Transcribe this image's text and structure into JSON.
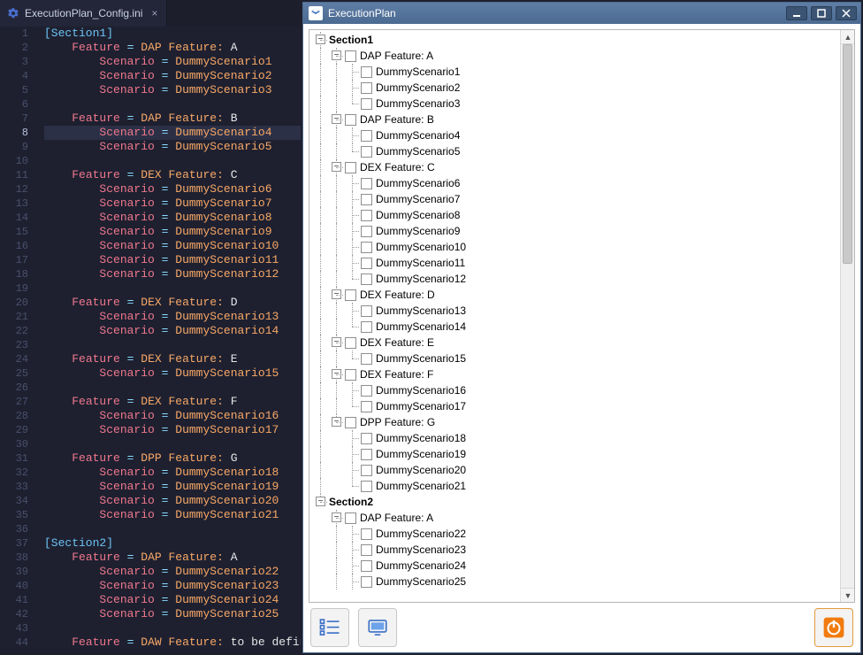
{
  "colors": {
    "editor_bg": "#1e2030",
    "section": "#6cc4f5",
    "key": "#f0788c",
    "eq": "#89ddff",
    "ident": "#f8a866",
    "val": "#e6e6e6",
    "titlebar": "#4b6a91",
    "accent_orange": "#f27b0f"
  },
  "editor": {
    "tab_title": "ExecutionPlan_Config.ini",
    "highlight_line": 8,
    "lines": [
      {
        "n": 1,
        "type": "section",
        "text": "[Section1]"
      },
      {
        "n": 2,
        "type": "kv",
        "indent": 1,
        "key": "Feature",
        "rhs_prefix": "DAP Feature:",
        "rhs_value": "A"
      },
      {
        "n": 3,
        "type": "kv",
        "indent": 2,
        "key": "Scenario",
        "rhs_value": "DummyScenario1"
      },
      {
        "n": 4,
        "type": "kv",
        "indent": 2,
        "key": "Scenario",
        "rhs_value": "DummyScenario2"
      },
      {
        "n": 5,
        "type": "kv",
        "indent": 2,
        "key": "Scenario",
        "rhs_value": "DummyScenario3"
      },
      {
        "n": 6,
        "type": "blank"
      },
      {
        "n": 7,
        "type": "kv",
        "indent": 1,
        "key": "Feature",
        "rhs_prefix": "DAP Feature:",
        "rhs_value": "B"
      },
      {
        "n": 8,
        "type": "kv",
        "indent": 2,
        "key": "Scenario",
        "rhs_value": "DummyScenario4"
      },
      {
        "n": 9,
        "type": "kv",
        "indent": 2,
        "key": "Scenario",
        "rhs_value": "DummyScenario5"
      },
      {
        "n": 10,
        "type": "blank"
      },
      {
        "n": 11,
        "type": "kv",
        "indent": 1,
        "key": "Feature",
        "rhs_prefix": "DEX Feature:",
        "rhs_value": "C"
      },
      {
        "n": 12,
        "type": "kv",
        "indent": 2,
        "key": "Scenario",
        "rhs_value": "DummyScenario6"
      },
      {
        "n": 13,
        "type": "kv",
        "indent": 2,
        "key": "Scenario",
        "rhs_value": "DummyScenario7"
      },
      {
        "n": 14,
        "type": "kv",
        "indent": 2,
        "key": "Scenario",
        "rhs_value": "DummyScenario8"
      },
      {
        "n": 15,
        "type": "kv",
        "indent": 2,
        "key": "Scenario",
        "rhs_value": "DummyScenario9"
      },
      {
        "n": 16,
        "type": "kv",
        "indent": 2,
        "key": "Scenario",
        "rhs_value": "DummyScenario10"
      },
      {
        "n": 17,
        "type": "kv",
        "indent": 2,
        "key": "Scenario",
        "rhs_value": "DummyScenario11"
      },
      {
        "n": 18,
        "type": "kv",
        "indent": 2,
        "key": "Scenario",
        "rhs_value": "DummyScenario12"
      },
      {
        "n": 19,
        "type": "blank"
      },
      {
        "n": 20,
        "type": "kv",
        "indent": 1,
        "key": "Feature",
        "rhs_prefix": "DEX Feature:",
        "rhs_value": "D"
      },
      {
        "n": 21,
        "type": "kv",
        "indent": 2,
        "key": "Scenario",
        "rhs_value": "DummyScenario13"
      },
      {
        "n": 22,
        "type": "kv",
        "indent": 2,
        "key": "Scenario",
        "rhs_value": "DummyScenario14"
      },
      {
        "n": 23,
        "type": "blank"
      },
      {
        "n": 24,
        "type": "kv",
        "indent": 1,
        "key": "Feature",
        "rhs_prefix": "DEX Feature:",
        "rhs_value": "E"
      },
      {
        "n": 25,
        "type": "kv",
        "indent": 2,
        "key": "Scenario",
        "rhs_value": "DummyScenario15"
      },
      {
        "n": 26,
        "type": "blank"
      },
      {
        "n": 27,
        "type": "kv",
        "indent": 1,
        "key": "Feature",
        "rhs_prefix": "DEX Feature:",
        "rhs_value": "F"
      },
      {
        "n": 28,
        "type": "kv",
        "indent": 2,
        "key": "Scenario",
        "rhs_value": "DummyScenario16"
      },
      {
        "n": 29,
        "type": "kv",
        "indent": 2,
        "key": "Scenario",
        "rhs_value": "DummyScenario17"
      },
      {
        "n": 30,
        "type": "blank"
      },
      {
        "n": 31,
        "type": "kv",
        "indent": 1,
        "key": "Feature",
        "rhs_prefix": "DPP Feature:",
        "rhs_value": "G"
      },
      {
        "n": 32,
        "type": "kv",
        "indent": 2,
        "key": "Scenario",
        "rhs_value": "DummyScenario18"
      },
      {
        "n": 33,
        "type": "kv",
        "indent": 2,
        "key": "Scenario",
        "rhs_value": "DummyScenario19"
      },
      {
        "n": 34,
        "type": "kv",
        "indent": 2,
        "key": "Scenario",
        "rhs_value": "DummyScenario20"
      },
      {
        "n": 35,
        "type": "kv",
        "indent": 2,
        "key": "Scenario",
        "rhs_value": "DummyScenario21"
      },
      {
        "n": 36,
        "type": "blank"
      },
      {
        "n": 37,
        "type": "section",
        "text": "[Section2]"
      },
      {
        "n": 38,
        "type": "kv",
        "indent": 1,
        "key": "Feature",
        "rhs_prefix": "DAP Feature:",
        "rhs_value": "A"
      },
      {
        "n": 39,
        "type": "kv",
        "indent": 2,
        "key": "Scenario",
        "rhs_value": "DummyScenario22"
      },
      {
        "n": 40,
        "type": "kv",
        "indent": 2,
        "key": "Scenario",
        "rhs_value": "DummyScenario23"
      },
      {
        "n": 41,
        "type": "kv",
        "indent": 2,
        "key": "Scenario",
        "rhs_value": "DummyScenario24"
      },
      {
        "n": 42,
        "type": "kv",
        "indent": 2,
        "key": "Scenario",
        "rhs_value": "DummyScenario25"
      },
      {
        "n": 43,
        "type": "blank"
      },
      {
        "n": 44,
        "type": "kv",
        "indent": 1,
        "key": "Feature",
        "rhs_prefix": "DAW Feature:",
        "rhs_value": "to be define"
      }
    ]
  },
  "app": {
    "title": "ExecutionPlan",
    "tree": [
      {
        "level": 0,
        "kind": "section",
        "expandable": true,
        "label": "Section1",
        "last": false
      },
      {
        "level": 1,
        "kind": "feature",
        "expandable": true,
        "label": "DAP Feature: A",
        "last": false
      },
      {
        "level": 2,
        "kind": "leaf",
        "label": "DummyScenario1",
        "last": false
      },
      {
        "level": 2,
        "kind": "leaf",
        "label": "DummyScenario2",
        "last": false
      },
      {
        "level": 2,
        "kind": "leaf",
        "label": "DummyScenario3",
        "last": true
      },
      {
        "level": 1,
        "kind": "feature",
        "expandable": true,
        "label": "DAP Feature: B",
        "last": false
      },
      {
        "level": 2,
        "kind": "leaf",
        "label": "DummyScenario4",
        "last": false
      },
      {
        "level": 2,
        "kind": "leaf",
        "label": "DummyScenario5",
        "last": true
      },
      {
        "level": 1,
        "kind": "feature",
        "expandable": true,
        "label": "DEX Feature: C",
        "last": false
      },
      {
        "level": 2,
        "kind": "leaf",
        "label": "DummyScenario6",
        "last": false
      },
      {
        "level": 2,
        "kind": "leaf",
        "label": "DummyScenario7",
        "last": false
      },
      {
        "level": 2,
        "kind": "leaf",
        "label": "DummyScenario8",
        "last": false
      },
      {
        "level": 2,
        "kind": "leaf",
        "label": "DummyScenario9",
        "last": false
      },
      {
        "level": 2,
        "kind": "leaf",
        "label": "DummyScenario10",
        "last": false
      },
      {
        "level": 2,
        "kind": "leaf",
        "label": "DummyScenario11",
        "last": false
      },
      {
        "level": 2,
        "kind": "leaf",
        "label": "DummyScenario12",
        "last": true
      },
      {
        "level": 1,
        "kind": "feature",
        "expandable": true,
        "label": "DEX Feature: D",
        "last": false
      },
      {
        "level": 2,
        "kind": "leaf",
        "label": "DummyScenario13",
        "last": false
      },
      {
        "level": 2,
        "kind": "leaf",
        "label": "DummyScenario14",
        "last": true
      },
      {
        "level": 1,
        "kind": "feature",
        "expandable": true,
        "label": "DEX Feature: E",
        "last": false
      },
      {
        "level": 2,
        "kind": "leaf",
        "label": "DummyScenario15",
        "last": true
      },
      {
        "level": 1,
        "kind": "feature",
        "expandable": true,
        "label": "DEX Feature: F",
        "last": false
      },
      {
        "level": 2,
        "kind": "leaf",
        "label": "DummyScenario16",
        "last": false
      },
      {
        "level": 2,
        "kind": "leaf",
        "label": "DummyScenario17",
        "last": true
      },
      {
        "level": 1,
        "kind": "feature",
        "expandable": true,
        "label": "DPP Feature: G",
        "last": true
      },
      {
        "level": 2,
        "kind": "leaf",
        "label": "DummyScenario18",
        "last": false
      },
      {
        "level": 2,
        "kind": "leaf",
        "label": "DummyScenario19",
        "last": false
      },
      {
        "level": 2,
        "kind": "leaf",
        "label": "DummyScenario20",
        "last": false
      },
      {
        "level": 2,
        "kind": "leaf",
        "label": "DummyScenario21",
        "last": true
      },
      {
        "level": 0,
        "kind": "section",
        "expandable": true,
        "label": "Section2",
        "last": true
      },
      {
        "level": 1,
        "kind": "feature",
        "expandable": true,
        "label": "DAP Feature: A",
        "last": false
      },
      {
        "level": 2,
        "kind": "leaf",
        "label": "DummyScenario22",
        "last": false
      },
      {
        "level": 2,
        "kind": "leaf",
        "label": "DummyScenario23",
        "last": false
      },
      {
        "level": 2,
        "kind": "leaf",
        "label": "DummyScenario24",
        "last": false
      },
      {
        "level": 2,
        "kind": "leaf",
        "label": "DummyScenario25",
        "last": false
      }
    ]
  }
}
